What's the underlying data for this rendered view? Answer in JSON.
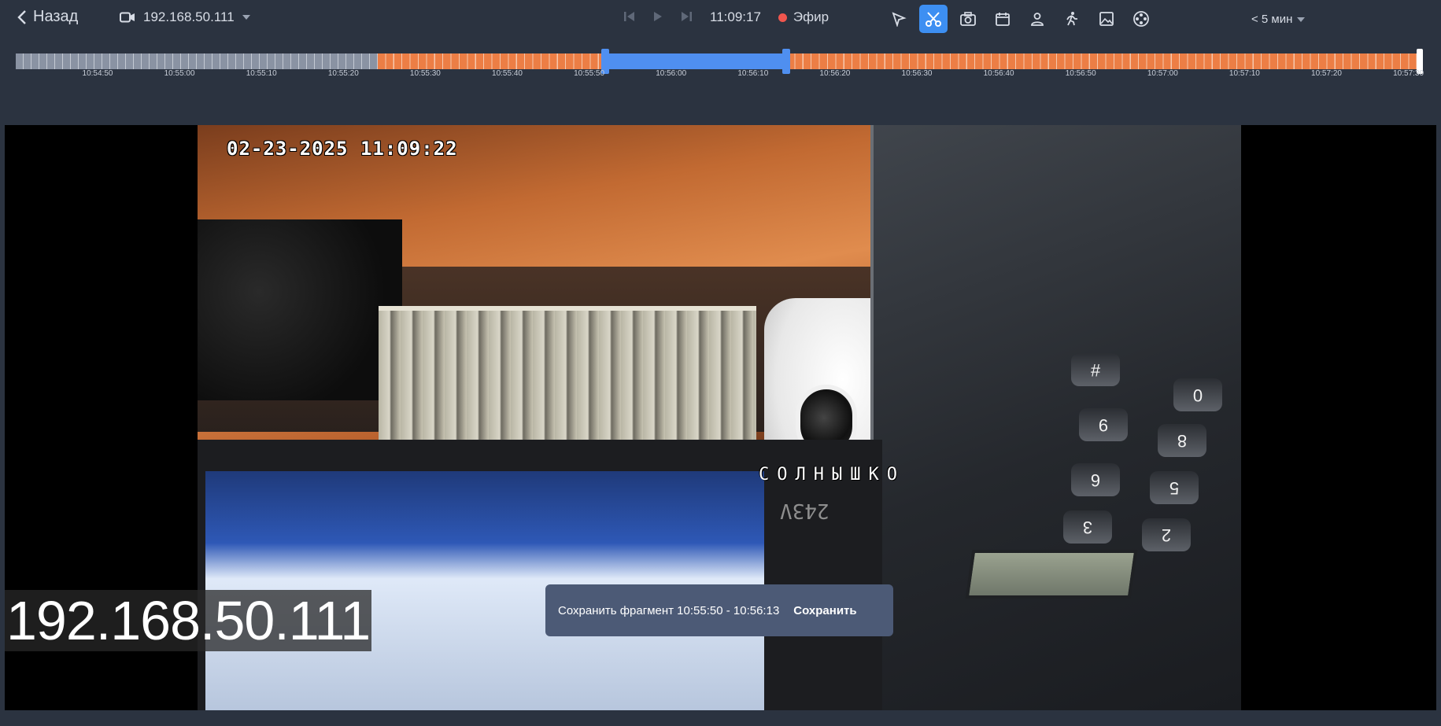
{
  "header": {
    "back_label": "Назад",
    "camera_name": "192.168.50.111",
    "current_time": "11:09:17",
    "live_label": "Эфир",
    "range_label": "< 5 мин"
  },
  "tools": [
    {
      "icon": "cursor-icon",
      "active": false
    },
    {
      "icon": "scissors-icon",
      "active": true
    },
    {
      "icon": "camera-snapshot-icon",
      "active": false
    },
    {
      "icon": "calendar-icon",
      "active": false
    },
    {
      "icon": "person-icon",
      "active": false
    },
    {
      "icon": "walking-person-icon",
      "active": false
    },
    {
      "icon": "image-icon",
      "active": false
    },
    {
      "icon": "film-reel-icon",
      "active": false
    }
  ],
  "timeline": {
    "ticks": [
      "10:54:50",
      "10:55:00",
      "10:55:10",
      "10:55:20",
      "10:55:30",
      "10:55:40",
      "10:55:50",
      "10:56:00",
      "10:56:10",
      "10:56:20",
      "10:56:30",
      "10:56:40",
      "10:56:50",
      "10:57:00",
      "10:57:10",
      "10:57:20",
      "10:57:30"
    ],
    "colors": {
      "recorded": "#ec7e45",
      "empty": "#8a93a3",
      "selection": "#4f8ff0"
    }
  },
  "video": {
    "osd_timestamp": "02-23-2025 11:09:22",
    "osd_camera_label": "СОЛНЫШКО",
    "ip_overlay": "192.168.50.111"
  },
  "toast": {
    "message": "Сохранить фрагмент 10:55:50 - 10:56:13",
    "save_label": "Сохранить"
  }
}
